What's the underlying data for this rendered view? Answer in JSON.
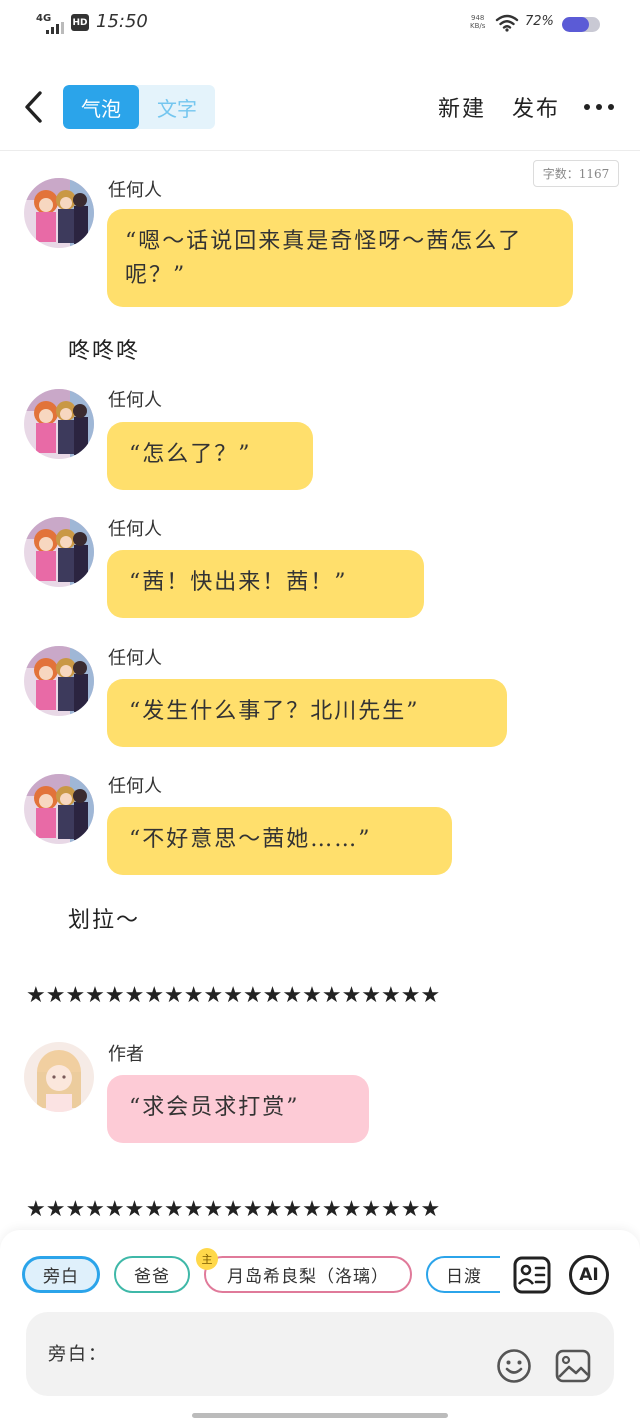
{
  "status_bar": {
    "network": "4G",
    "hd": "HD",
    "time": "15:50",
    "speed_value": "948",
    "speed_unit": "KB/s",
    "battery_text": "72%",
    "battery_level": 0.72
  },
  "header": {
    "tabs": [
      {
        "label": "气泡",
        "active": true
      },
      {
        "label": "文字",
        "active": false
      }
    ],
    "new_label": "新建",
    "publish_label": "发布"
  },
  "word_count": "字数：1167",
  "messages": [
    {
      "speaker": "任何人",
      "text": "“嗯～话说回来真是奇怪呀～茜怎么了呢？”"
    },
    {
      "speaker": "任何人",
      "text": "“怎么了？”"
    },
    {
      "speaker": "任何人",
      "text": "“茜！快出来！茜！”"
    },
    {
      "speaker": "任何人",
      "text": "“发生什么事了？北川先生”"
    },
    {
      "speaker": "任何人",
      "text": "“不好意思～茜她……”"
    },
    {
      "speaker": "作者",
      "text": "“求会员求打赏”"
    }
  ],
  "narrations": [
    "咚咚咚",
    "划拉～"
  ],
  "divider_stars": "★★★★★★★★★★★★★★★★★★★★★",
  "bottom": {
    "characters": [
      "旁白",
      "爸爸",
      "月岛希良梨（洛璃）",
      "日渡"
    ],
    "main_badge": "主",
    "ai_label": "AI",
    "input_label": "旁白："
  },
  "colors": {
    "accent": "#2ba4ea",
    "bubble_yellow": "#ffdf6c",
    "bubble_pink": "#fdcbd6"
  },
  "icons": [
    "back-arrow-icon",
    "more-icon",
    "character-card-icon",
    "ai-icon",
    "emoji-icon",
    "image-icon",
    "wifi-icon",
    "signal-icon"
  ]
}
